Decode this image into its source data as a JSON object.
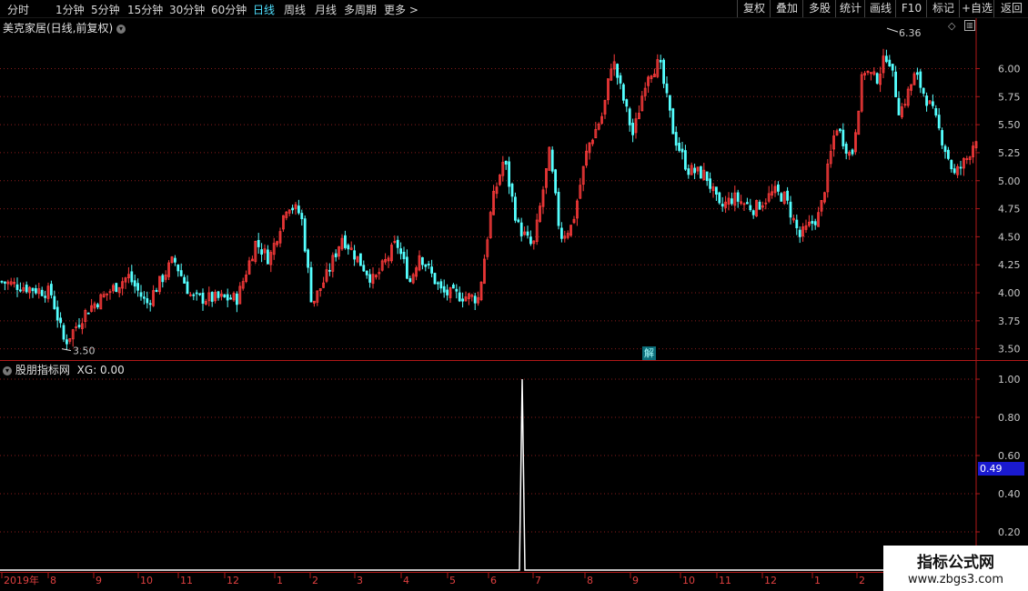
{
  "toolbar": {
    "periods": [
      "分时",
      "1分钟",
      "5分钟",
      "15分钟",
      "30分钟",
      "60分钟",
      "日线",
      "周线",
      "月线",
      "多周期",
      "更多 >"
    ],
    "active_period": "日线",
    "actions": [
      "复权",
      "叠加",
      "多股",
      "统计",
      "画线",
      "F10",
      "标记",
      "+自选",
      "返回"
    ]
  },
  "main_chart": {
    "title": "美克家居(日线,前复权)",
    "high_label": "6.36",
    "low_label": "3.50",
    "y_ticks": [
      "6.00",
      "5.75",
      "5.50",
      "5.25",
      "5.00",
      "4.75",
      "4.50",
      "4.25",
      "4.00",
      "3.75",
      "3.50"
    ],
    "jie_label": "解",
    "colors": {
      "up": "#ff3b3b",
      "down": "#54ffff",
      "grid": "#8a1c1c",
      "axis": "#b01818"
    }
  },
  "indicator": {
    "title": "股朋指标网",
    "xg_label": "XG: 0.00",
    "y_ticks": [
      "1.00",
      "0.80",
      "0.60",
      "0.40",
      "0.20"
    ],
    "current_value": "0.49"
  },
  "x_axis": {
    "labels": [
      "2019年",
      "8",
      "9",
      "10",
      "11",
      "12",
      "1",
      "2",
      "3",
      "4",
      "5",
      "6",
      "7",
      "8",
      "9",
      "10",
      "11",
      "12",
      "1",
      "2"
    ]
  },
  "watermark": {
    "line1": "指标公式网",
    "line2": "www.zbgs3.com"
  },
  "chart_data": {
    "type": "candlestick",
    "ylim": [
      3.4,
      6.45
    ],
    "key_points": [
      {
        "x": 0,
        "y": 4.1
      },
      {
        "x": 55,
        "y": 4.0
      },
      {
        "x": 70,
        "y": 3.55
      },
      {
        "x": 95,
        "y": 3.85
      },
      {
        "x": 140,
        "y": 4.15
      },
      {
        "x": 160,
        "y": 3.9
      },
      {
        "x": 190,
        "y": 4.3
      },
      {
        "x": 210,
        "y": 3.95
      },
      {
        "x": 260,
        "y": 3.95
      },
      {
        "x": 280,
        "y": 4.45
      },
      {
        "x": 295,
        "y": 4.3
      },
      {
        "x": 315,
        "y": 4.8
      },
      {
        "x": 330,
        "y": 4.7
      },
      {
        "x": 342,
        "y": 3.9
      },
      {
        "x": 358,
        "y": 4.15
      },
      {
        "x": 375,
        "y": 4.5
      },
      {
        "x": 410,
        "y": 4.1
      },
      {
        "x": 435,
        "y": 4.45
      },
      {
        "x": 450,
        "y": 4.1
      },
      {
        "x": 460,
        "y": 4.35
      },
      {
        "x": 485,
        "y": 4.0
      },
      {
        "x": 525,
        "y": 3.95
      },
      {
        "x": 540,
        "y": 4.8
      },
      {
        "x": 553,
        "y": 5.2
      },
      {
        "x": 568,
        "y": 4.6
      },
      {
        "x": 585,
        "y": 4.4
      },
      {
        "x": 603,
        "y": 5.25
      },
      {
        "x": 615,
        "y": 4.5
      },
      {
        "x": 628,
        "y": 4.6
      },
      {
        "x": 645,
        "y": 5.3
      },
      {
        "x": 662,
        "y": 5.6
      },
      {
        "x": 672,
        "y": 6.1
      },
      {
        "x": 695,
        "y": 5.4
      },
      {
        "x": 710,
        "y": 5.95
      },
      {
        "x": 724,
        "y": 6.05
      },
      {
        "x": 740,
        "y": 5.4
      },
      {
        "x": 755,
        "y": 5.1
      },
      {
        "x": 775,
        "y": 5.05
      },
      {
        "x": 790,
        "y": 4.75
      },
      {
        "x": 805,
        "y": 4.85
      },
      {
        "x": 828,
        "y": 4.75
      },
      {
        "x": 850,
        "y": 4.9
      },
      {
        "x": 862,
        "y": 4.85
      },
      {
        "x": 878,
        "y": 4.5
      },
      {
        "x": 900,
        "y": 4.7
      },
      {
        "x": 918,
        "y": 5.5
      },
      {
        "x": 935,
        "y": 5.2
      },
      {
        "x": 948,
        "y": 6.0
      },
      {
        "x": 962,
        "y": 5.9
      },
      {
        "x": 975,
        "y": 6.15
      },
      {
        "x": 988,
        "y": 5.6
      },
      {
        "x": 1005,
        "y": 5.95
      },
      {
        "x": 1025,
        "y": 5.6
      },
      {
        "x": 1048,
        "y": 5.05
      },
      {
        "x": 1062,
        "y": 5.2
      },
      {
        "x": 1075,
        "y": 5.45
      }
    ],
    "signal": {
      "bar_index_x": 574,
      "value": 1.0
    }
  }
}
